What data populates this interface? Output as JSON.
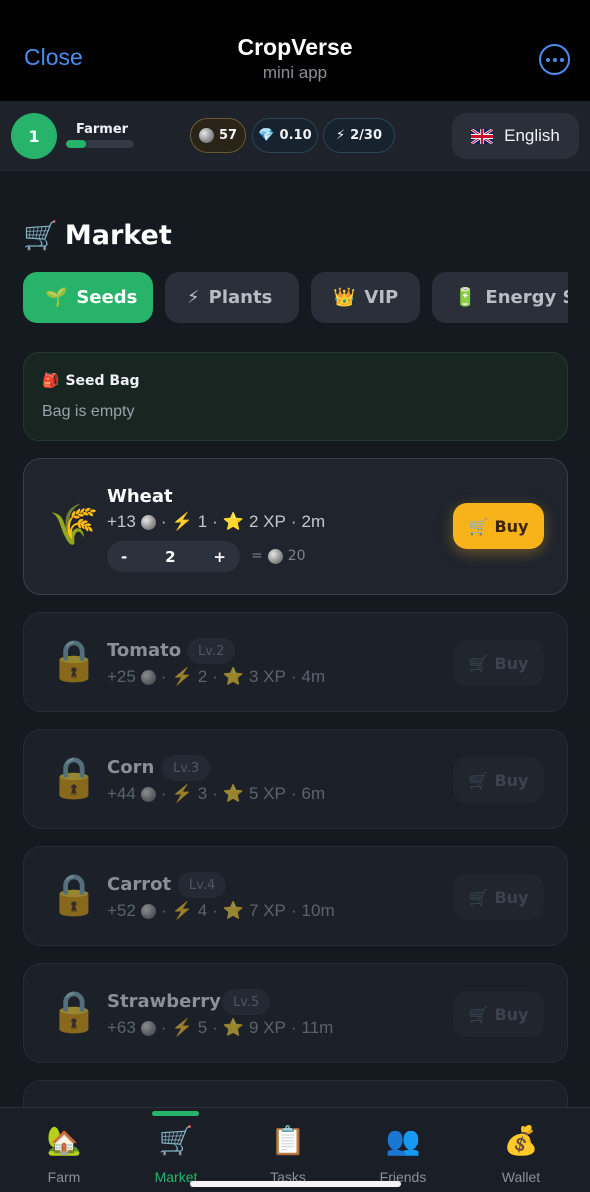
{
  "header": {
    "close_label": "Close",
    "title": "CropVerse",
    "subtitle": "mini app",
    "more_icon": "more-dots-icon"
  },
  "status": {
    "level": "1",
    "rank": "Farmer",
    "xp_progress": 0.3,
    "coins": "57",
    "gems": "0.10",
    "energy": "2/30",
    "language": "English",
    "language_flag": "uk-flag-icon"
  },
  "market": {
    "icon": "🛒",
    "title": "Market",
    "tabs": [
      {
        "icon": "🌱",
        "label": "Seeds",
        "active": true
      },
      {
        "icon": "⚡",
        "label": "Plants",
        "active": false
      },
      {
        "icon": "👑",
        "label": "VIP",
        "active": false
      },
      {
        "icon": "🔋",
        "label": "Energy St",
        "active": false
      }
    ],
    "seed_bag": {
      "icon": "🎒",
      "title": "Seed Bag",
      "text": "Bag is empty"
    },
    "crops": [
      {
        "name": "Wheat",
        "icon": "🌾",
        "locked": false,
        "level": "",
        "coins": "+13",
        "energy": "1",
        "xp": "2 XP",
        "time": "2m",
        "quantity": "2",
        "total": "20",
        "buy_label": "Buy"
      },
      {
        "name": "Tomato",
        "icon": "🔒",
        "locked": true,
        "level": "Lv.2",
        "coins": "+25",
        "energy": "2",
        "xp": "3 XP",
        "time": "4m",
        "buy_label": "Buy"
      },
      {
        "name": "Corn",
        "icon": "🔒",
        "locked": true,
        "level": "Lv.3",
        "coins": "+44",
        "energy": "3",
        "xp": "5 XP",
        "time": "6m",
        "buy_label": "Buy"
      },
      {
        "name": "Carrot",
        "icon": "🔒",
        "locked": true,
        "level": "Lv.4",
        "coins": "+52",
        "energy": "4",
        "xp": "7 XP",
        "time": "10m",
        "buy_label": "Buy"
      },
      {
        "name": "Strawberry",
        "icon": "🔒",
        "locked": true,
        "level": "Lv.5",
        "coins": "+63",
        "energy": "5",
        "xp": "9 XP",
        "time": "11m",
        "buy_label": "Buy"
      }
    ],
    "stepper": {
      "minus": "-",
      "plus": "+",
      "equals": "="
    }
  },
  "nav": {
    "items": [
      {
        "icon": "🏡",
        "label": "Farm",
        "active": false
      },
      {
        "icon": "🛒",
        "label": "Market",
        "active": true
      },
      {
        "icon": "📋",
        "label": "Tasks",
        "active": false
      },
      {
        "icon": "👥",
        "label": "Friends",
        "active": false
      },
      {
        "icon": "💰",
        "label": "Wallet",
        "active": false
      }
    ]
  }
}
